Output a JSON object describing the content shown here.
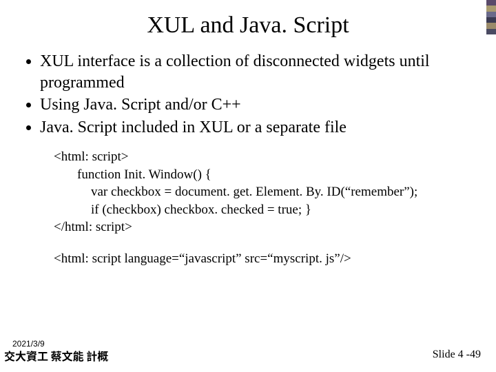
{
  "title": "XUL and Java. Script",
  "bullets": [
    "XUL interface is a collection of disconnected widgets until programmed",
    "Using Java. Script and/or C++",
    "Java. Script included in XUL or a separate file"
  ],
  "code": {
    "l1": "<html: script>",
    "l2": "function Init. Window() {",
    "l3": "var checkbox = document. get. Element. By. ID(“remember”);",
    "l4": "if (checkbox) checkbox. checked = true; }",
    "l5": "</html: script>"
  },
  "code2": "<html: script language=“javascript” src=“myscript. js”/>",
  "footer": {
    "date": "2021/3/9",
    "author": "交大資工 蔡文能 計概",
    "slide": "Slide 4 -49"
  }
}
